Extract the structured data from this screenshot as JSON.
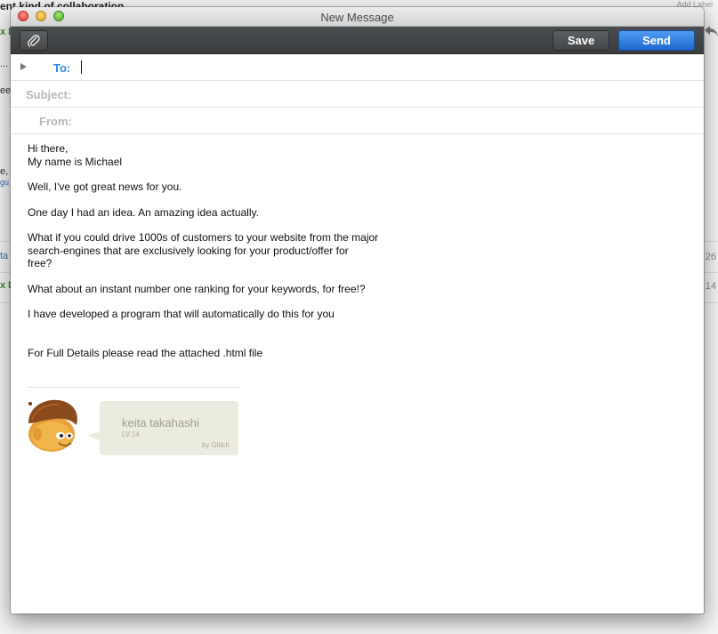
{
  "background": {
    "title_fragment": "ent kind of collaboration",
    "add_label": "Add Label",
    "fragments": [
      {
        "text": "x D",
        "color": "#3a8a2a"
      },
      {
        "text": "...",
        "color": "#333333"
      },
      {
        "text": "ee",
        "color": "#333333"
      },
      {
        "text": "e, A",
        "color": "#333333"
      },
      {
        "text": "gu",
        "color": "#2f6fc1"
      },
      {
        "text": "ta",
        "color": "#2f6fc1"
      },
      {
        "text": "x D",
        "color": "#3a8a2a"
      }
    ],
    "dates": [
      "26",
      "14"
    ]
  },
  "window": {
    "title": "New Message"
  },
  "toolbar": {
    "attach_icon": "paperclip-icon",
    "save_label": "Save",
    "send_label": "Send"
  },
  "fields": {
    "to_label": "To:",
    "to_value": "",
    "subject_label": "Subject:",
    "subject_value": "",
    "from_label": "From:",
    "from_value": ""
  },
  "body": {
    "lines": [
      "Hi there,\nMy name is Michael",
      "Well, I've got great news for you.",
      "One day I had an idea. An amazing idea actually.",
      "What if you could drive 1000s of customers to your website from the major\nsearch-engines that are exclusively looking for your product/offer for\nfree?",
      "What about an instant number one ranking for your keywords, for free!?",
      "I have developed a program that will automatically do this for you",
      "For Full Details please read the attached .html file"
    ]
  },
  "signature": {
    "name": "keita takahashi",
    "level": "LV.14",
    "by": "by Glitch",
    "colors": {
      "bubble": "#ecebdf",
      "text": "#a09f94"
    }
  },
  "colors": {
    "send_blue": "#2f7fe3",
    "to_label_blue": "#2f8ae6",
    "toolbar_dark": "#404244"
  }
}
